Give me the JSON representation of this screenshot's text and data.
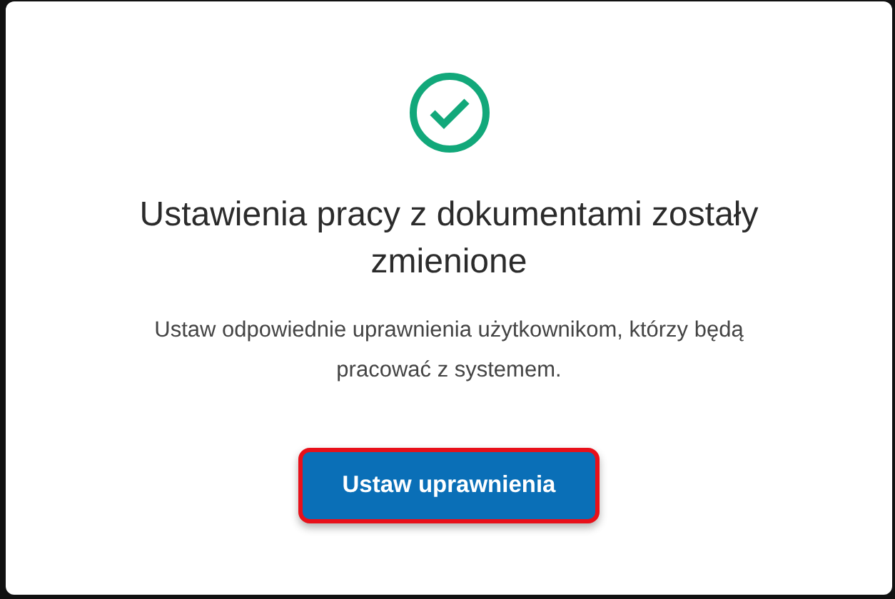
{
  "dialog": {
    "title": "Ustawienia pracy z dokumentami zostały zmienione",
    "message": "Ustaw odpowiednie uprawnienia użytkownikom, którzy będą pracować z systemem.",
    "button": "Ustaw uprawnienia"
  }
}
